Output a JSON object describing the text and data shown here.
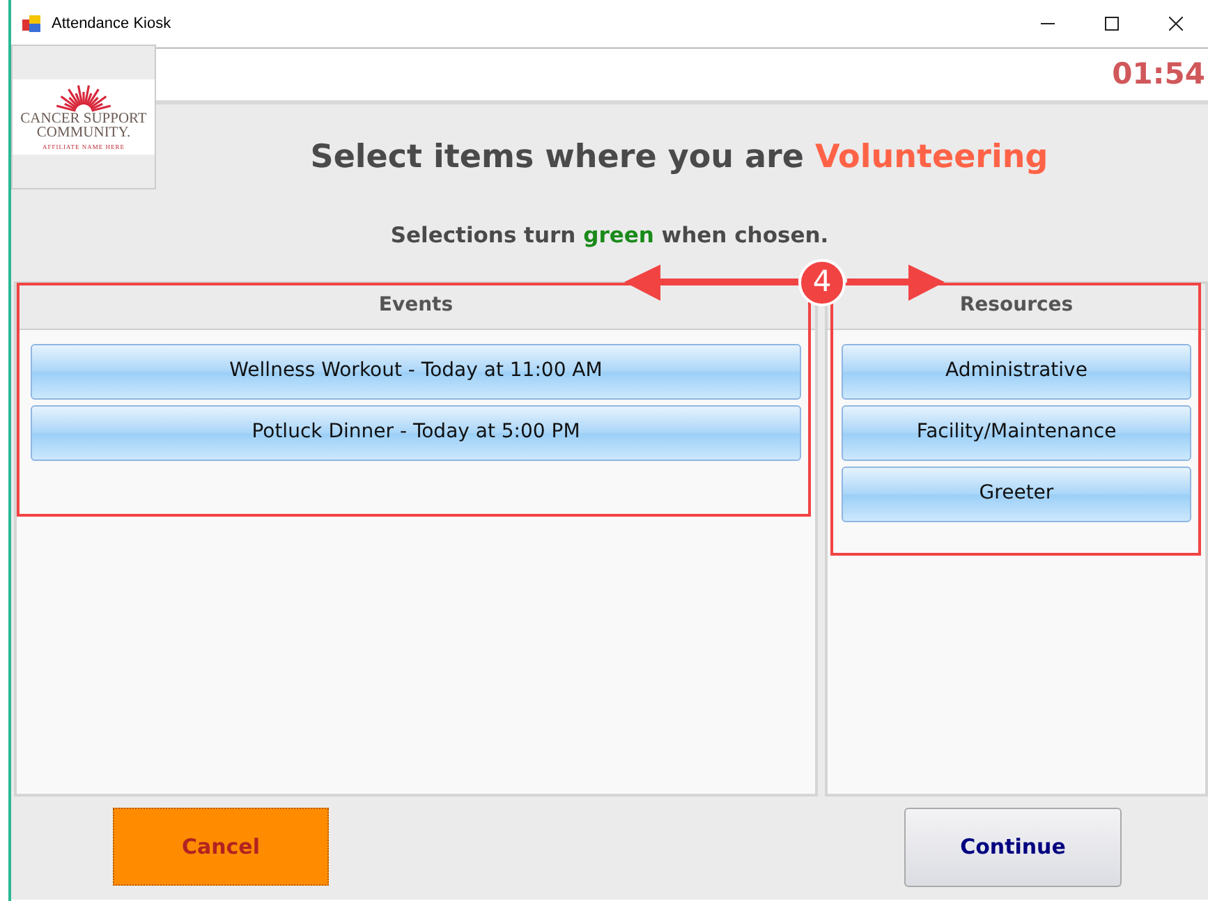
{
  "window": {
    "title": "Attendance Kiosk"
  },
  "timer": "01:54",
  "logo": {
    "line_1": "CANCER SUPPORT",
    "line_2": "COMMUNITY.",
    "tagline": "AFFILIATE NAME HERE"
  },
  "heading": {
    "text": "Select items where you are",
    "role": "Volunteering"
  },
  "hint": {
    "before": "Selections turn",
    "highlight": "green",
    "after": "when chosen."
  },
  "panels": [
    {
      "title": "Events",
      "items": [
        {
          "label": "Wellness Workout - Today at 11:00 AM",
          "selected": false
        },
        {
          "label": "Potluck Dinner - Today at 5:00 PM",
          "selected": false
        }
      ]
    },
    {
      "title": "Resources",
      "items": [
        {
          "label": "Administrative",
          "selected": false
        },
        {
          "label": "Facility/Maintenance",
          "selected": false
        },
        {
          "label": "Greeter",
          "selected": false
        }
      ]
    }
  ],
  "buttons": [
    {
      "label": "Cancel",
      "kind": "cancel"
    },
    {
      "label": "Continue",
      "kind": "continue"
    }
  ],
  "annotation": {
    "badge": "4"
  }
}
